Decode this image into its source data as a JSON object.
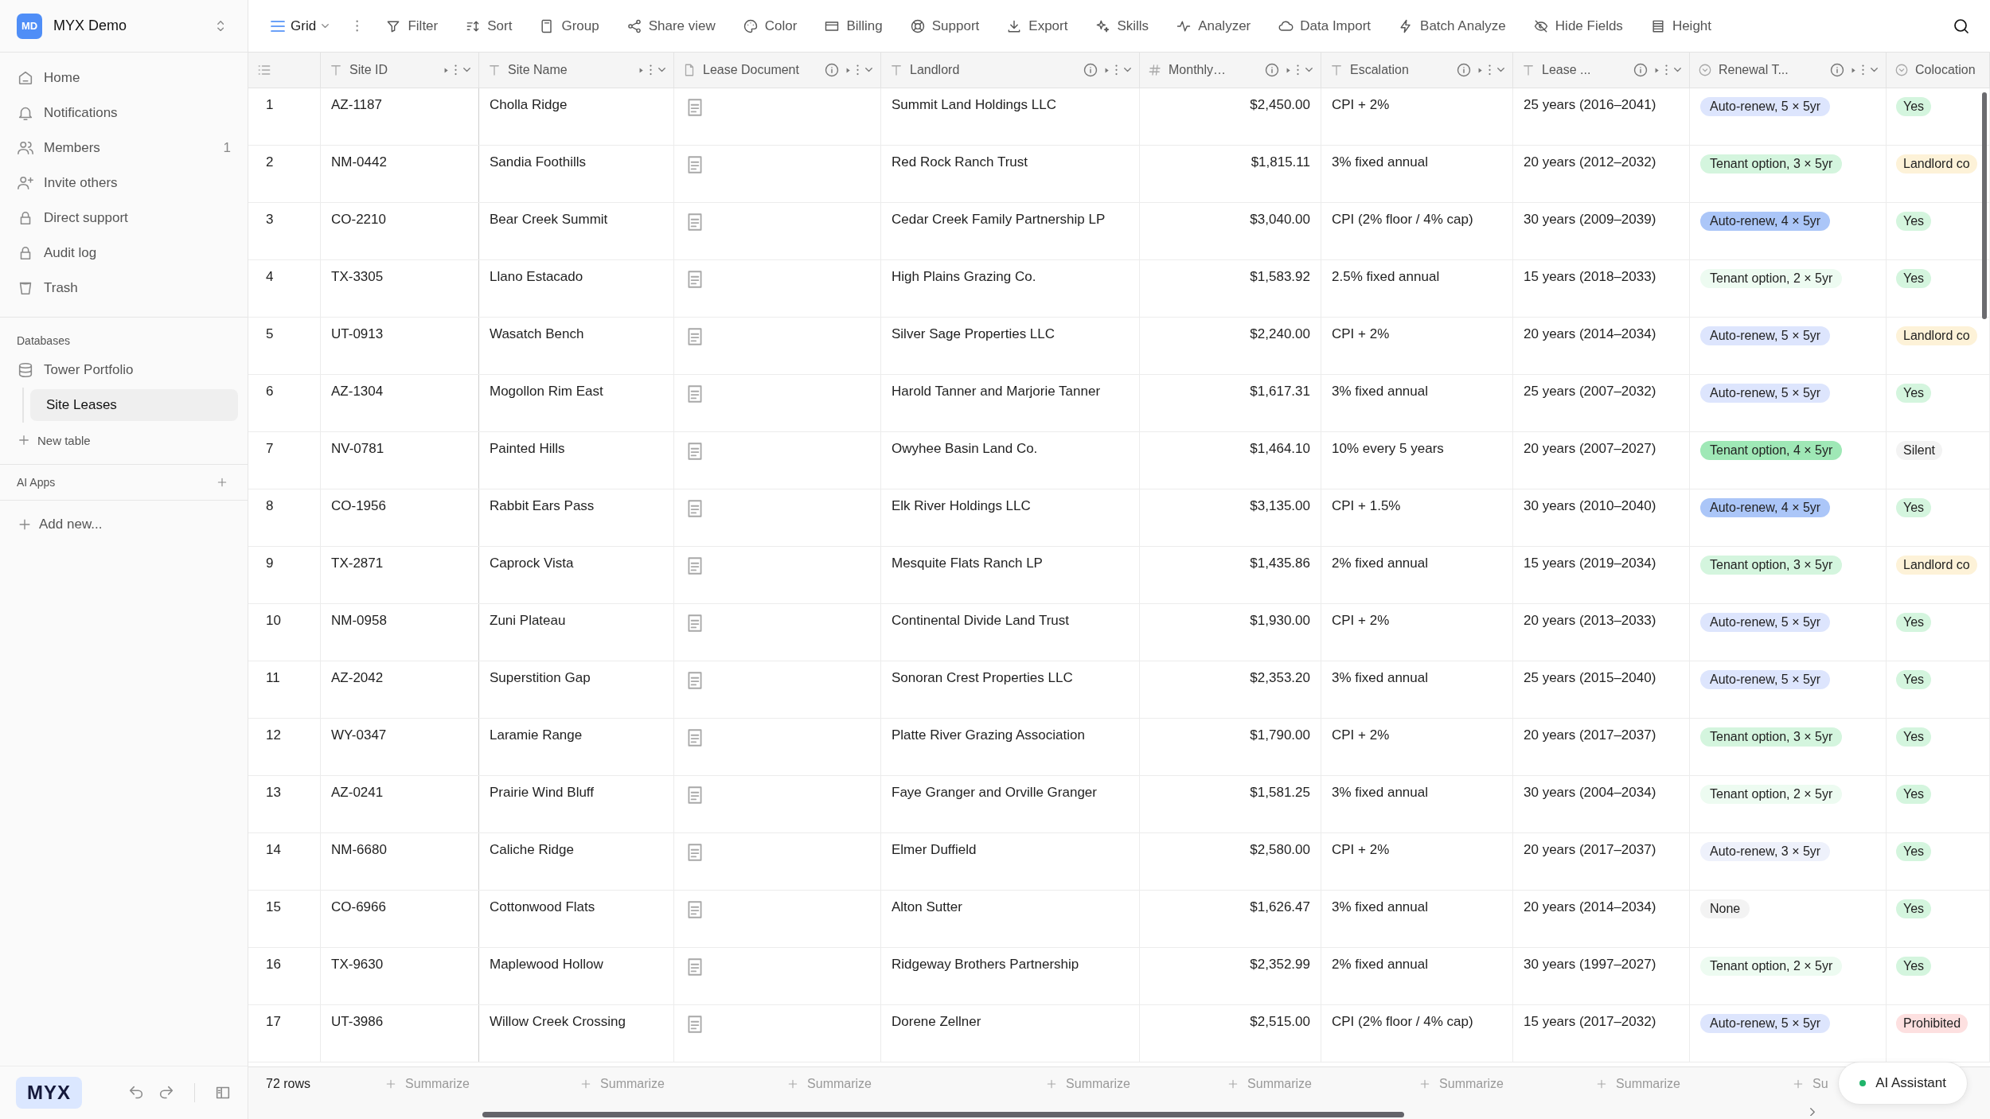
{
  "workspace": {
    "initials": "MD",
    "name": "MYX Demo"
  },
  "nav": [
    {
      "label": "Home"
    },
    {
      "label": "Notifications"
    },
    {
      "label": "Members",
      "count": "1"
    },
    {
      "label": "Invite others"
    },
    {
      "label": "Direct support"
    },
    {
      "label": "Audit log"
    },
    {
      "label": "Trash"
    }
  ],
  "databases": {
    "heading": "Databases",
    "items": [
      {
        "label": "Tower Portfolio",
        "children": [
          {
            "label": "Site Leases",
            "selected": true
          }
        ]
      }
    ],
    "new_table": "New table"
  },
  "ai_apps": {
    "heading": "AI Apps"
  },
  "add_new": "Add new...",
  "brand": {
    "logo": "MYX"
  },
  "toolbar": {
    "view": "Grid",
    "items": [
      "Filter",
      "Sort",
      "Group",
      "Share view",
      "Color",
      "Billing",
      "Support",
      "Export",
      "Skills",
      "Analyzer",
      "Data Import",
      "Batch Analyze",
      "Hide Fields",
      "Height"
    ]
  },
  "columns": [
    {
      "name": "Site ID",
      "info": false
    },
    {
      "name": "Site Name",
      "info": false
    },
    {
      "name": "Lease Document",
      "info": true
    },
    {
      "name": "Landlord",
      "info": true
    },
    {
      "name": "Monthly…",
      "info": true
    },
    {
      "name": "Escalation",
      "info": true
    },
    {
      "name": "Lease ...",
      "info": true
    },
    {
      "name": "Renewal T...",
      "info": true
    },
    {
      "name": "Colocation"
    }
  ],
  "rows": [
    {
      "num": "1",
      "site_id": "AZ-1187",
      "site_name": "Cholla Ridge",
      "landlord": "Summit Land Holdings LLC",
      "monthly": "$2,450.00",
      "escalation": "CPI + 2%",
      "lease_term": "25 years (2016–2041)",
      "renewal": {
        "text": "Auto-renew, 5 × 5yr",
        "color": "#dde5fd"
      },
      "colocation": {
        "text": "Yes",
        "color": "#d4f5de"
      }
    },
    {
      "num": "2",
      "site_id": "NM-0442",
      "site_name": "Sandia Foothills",
      "landlord": "Red Rock Ranch Trust",
      "monthly": "$1,815.11",
      "escalation": "3% fixed annual",
      "lease_term": "20 years (2012–2032)",
      "renewal": {
        "text": "Tenant option, 3 × 5yr",
        "color": "#d4f5de"
      },
      "colocation": {
        "text": "Landlord co",
        "color": "#fdf2d8"
      }
    },
    {
      "num": "3",
      "site_id": "CO-2210",
      "site_name": "Bear Creek Summit",
      "landlord": "Cedar Creek Family Partnership LP",
      "monthly": "$3,040.00",
      "escalation": "CPI (2% floor / 4% cap)",
      "lease_term": "30 years (2009–2039)",
      "renewal": {
        "text": "Auto-renew, 4 × 5yr",
        "color": "#abc6f8"
      },
      "colocation": {
        "text": "Yes",
        "color": "#d4f5de"
      }
    },
    {
      "num": "4",
      "site_id": "TX-3305",
      "site_name": "Llano Estacado",
      "landlord": "High Plains Grazing Co.",
      "monthly": "$1,583.92",
      "escalation": "2.5% fixed annual",
      "lease_term": "15 years (2018–2033)",
      "renewal": {
        "text": "Tenant option, 2 × 5yr",
        "color": "#edfbf1"
      },
      "colocation": {
        "text": "Yes",
        "color": "#d4f5de"
      }
    },
    {
      "num": "5",
      "site_id": "UT-0913",
      "site_name": "Wasatch Bench",
      "landlord": "Silver Sage Properties LLC",
      "monthly": "$2,240.00",
      "escalation": "CPI + 2%",
      "lease_term": "20 years (2014–2034)",
      "renewal": {
        "text": "Auto-renew, 5 × 5yr",
        "color": "#dde5fd"
      },
      "colocation": {
        "text": "Landlord co",
        "color": "#fdf2d8"
      }
    },
    {
      "num": "6",
      "site_id": "AZ-1304",
      "site_name": "Mogollon Rim East",
      "landlord": "Harold Tanner and Marjorie Tanner",
      "monthly": "$1,617.31",
      "escalation": "3% fixed annual",
      "lease_term": "25 years (2007–2032)",
      "renewal": {
        "text": "Auto-renew, 5 × 5yr",
        "color": "#dde5fd"
      },
      "colocation": {
        "text": "Yes",
        "color": "#d4f5de"
      }
    },
    {
      "num": "7",
      "site_id": "NV-0781",
      "site_name": "Painted Hills",
      "landlord": "Owyhee Basin Land Co.",
      "monthly": "$1,464.10",
      "escalation": "10% every 5 years",
      "lease_term": "20 years (2007–2027)",
      "renewal": {
        "text": "Tenant option, 4 × 5yr",
        "color": "#9fe8b6"
      },
      "colocation": {
        "text": "Silent",
        "color": "#f3f3f3"
      }
    },
    {
      "num": "8",
      "site_id": "CO-1956",
      "site_name": "Rabbit Ears Pass",
      "landlord": "Elk River Holdings LLC",
      "monthly": "$3,135.00",
      "escalation": "CPI + 1.5%",
      "lease_term": "30 years (2010–2040)",
      "renewal": {
        "text": "Auto-renew, 4 × 5yr",
        "color": "#abc6f8"
      },
      "colocation": {
        "text": "Yes",
        "color": "#d4f5de"
      }
    },
    {
      "num": "9",
      "site_id": "TX-2871",
      "site_name": "Caprock Vista",
      "landlord": "Mesquite Flats Ranch LP",
      "monthly": "$1,435.86",
      "escalation": "2% fixed annual",
      "lease_term": "15 years (2019–2034)",
      "renewal": {
        "text": "Tenant option, 3 × 5yr",
        "color": "#d4f5de"
      },
      "colocation": {
        "text": "Landlord co",
        "color": "#fdf2d8"
      }
    },
    {
      "num": "10",
      "site_id": "NM-0958",
      "site_name": "Zuni Plateau",
      "landlord": "Continental Divide Land Trust",
      "monthly": "$1,930.00",
      "escalation": "CPI + 2%",
      "lease_term": "20 years (2013–2033)",
      "renewal": {
        "text": "Auto-renew, 5 × 5yr",
        "color": "#dde5fd"
      },
      "colocation": {
        "text": "Yes",
        "color": "#d4f5de"
      }
    },
    {
      "num": "11",
      "site_id": "AZ-2042",
      "site_name": "Superstition Gap",
      "landlord": "Sonoran Crest Properties LLC",
      "monthly": "$2,353.20",
      "escalation": "3% fixed annual",
      "lease_term": "25 years (2015–2040)",
      "renewal": {
        "text": "Auto-renew, 5 × 5yr",
        "color": "#dde5fd"
      },
      "colocation": {
        "text": "Yes",
        "color": "#d4f5de"
      }
    },
    {
      "num": "12",
      "site_id": "WY-0347",
      "site_name": "Laramie Range",
      "landlord": "Platte River Grazing Association",
      "monthly": "$1,790.00",
      "escalation": "CPI + 2%",
      "lease_term": "20 years (2017–2037)",
      "renewal": {
        "text": "Tenant option, 3 × 5yr",
        "color": "#d4f5de"
      },
      "colocation": {
        "text": "Yes",
        "color": "#d4f5de"
      }
    },
    {
      "num": "13",
      "site_id": "AZ-0241",
      "site_name": "Prairie Wind Bluff",
      "landlord": "Faye Granger and Orville Granger",
      "monthly": "$1,581.25",
      "escalation": "3% fixed annual",
      "lease_term": "30 years (2004–2034)",
      "renewal": {
        "text": "Tenant option, 2 × 5yr",
        "color": "#edfbf1"
      },
      "colocation": {
        "text": "Yes",
        "color": "#d4f5de"
      }
    },
    {
      "num": "14",
      "site_id": "NM-6680",
      "site_name": "Caliche Ridge",
      "landlord": "Elmer Duffield",
      "monthly": "$2,580.00",
      "escalation": "CPI + 2%",
      "lease_term": "20 years (2017–2037)",
      "renewal": {
        "text": "Auto-renew, 3 × 5yr",
        "color": "#eef1fb"
      },
      "colocation": {
        "text": "Yes",
        "color": "#d4f5de"
      }
    },
    {
      "num": "15",
      "site_id": "CO-6966",
      "site_name": "Cottonwood Flats",
      "landlord": "Alton Sutter",
      "monthly": "$1,626.47",
      "escalation": "3% fixed annual",
      "lease_term": "20 years (2014–2034)",
      "renewal": {
        "text": "None",
        "color": "#f3f3f3"
      },
      "colocation": {
        "text": "Yes",
        "color": "#d4f5de"
      }
    },
    {
      "num": "16",
      "site_id": "TX-9630",
      "site_name": "Maplewood Hollow",
      "landlord": "Ridgeway Brothers Partnership",
      "monthly": "$2,352.99",
      "escalation": "2% fixed annual",
      "lease_term": "30 years (1997–2027)",
      "renewal": {
        "text": "Tenant option, 2 × 5yr",
        "color": "#edfbf1"
      },
      "colocation": {
        "text": "Yes",
        "color": "#d4f5de"
      }
    },
    {
      "num": "17",
      "site_id": "UT-3986",
      "site_name": "Willow Creek Crossing",
      "landlord": "Dorene Zellner",
      "monthly": "$2,515.00",
      "escalation": "CPI (2% floor / 4% cap)",
      "lease_term": "15 years (2017–2032)",
      "renewal": {
        "text": "Auto-renew, 5 × 5yr",
        "color": "#dde5fd"
      },
      "colocation": {
        "text": "Prohibited",
        "color": "#fde0e0"
      }
    }
  ],
  "footer": {
    "row_count": "72 rows",
    "summaries": [
      "Summarize",
      "Summarize",
      "Summarize",
      "Summarize",
      "Summarize",
      "Summarize",
      "Summarize",
      "Su"
    ]
  },
  "assistant": {
    "label": "AI Assistant"
  }
}
